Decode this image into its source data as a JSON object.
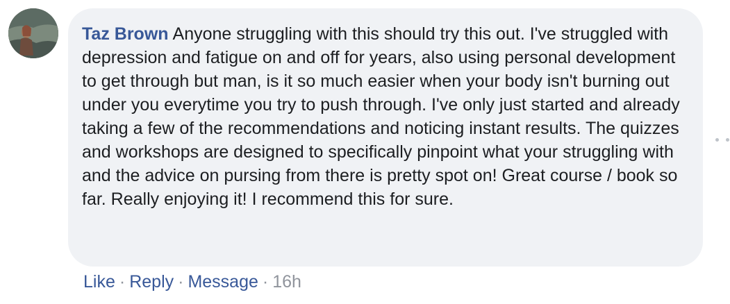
{
  "comment": {
    "author": "Taz Brown",
    "text": "Anyone struggling with this should try this out. I've struggled with depression and fatigue on and off for years, also using personal development to get through but man, is it so much easier when your body isn't burning out under you everytime you try to push through. I've only just started and already taking a few of the recommendations and noticing instant results. The quizzes and workshops are designed to specifically pinpoint what your struggling with and the advice on pursing from there is pretty spot on! Great course / book so far. Really enjoying it! I recommend this for sure."
  },
  "actions": {
    "like_label": "Like",
    "reply_label": "Reply",
    "message_label": "Message",
    "separator": "·",
    "timestamp": "16h"
  },
  "colors": {
    "link": "#385898",
    "bubble_bg": "#f0f2f5",
    "text": "#1c1e21",
    "meta": "#90949c"
  }
}
